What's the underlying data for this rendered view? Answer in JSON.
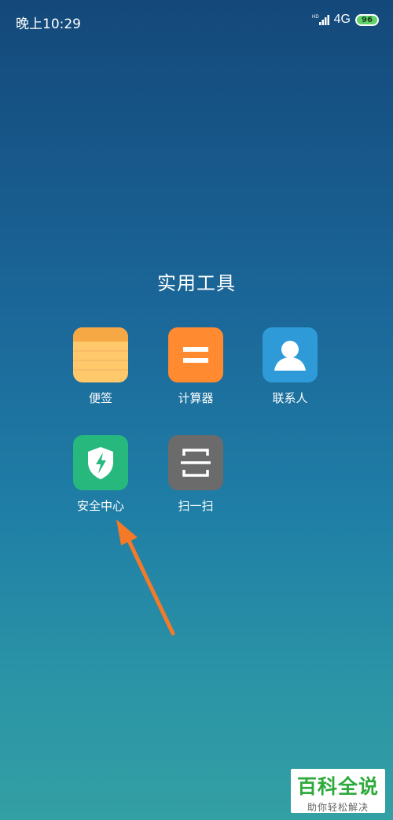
{
  "status_bar": {
    "time": "晚上10:29",
    "network": "4G",
    "battery": "96"
  },
  "folder": {
    "title": "实用工具",
    "apps": [
      {
        "label": "便签",
        "icon": "notes-icon",
        "color": "#ffc86b"
      },
      {
        "label": "计算器",
        "icon": "calculator-icon",
        "color": "#ff8a30"
      },
      {
        "label": "联系人",
        "icon": "contacts-icon",
        "color": "#2f9ad8"
      },
      {
        "label": "安全中心",
        "icon": "security-center-icon",
        "color": "#27b87e"
      },
      {
        "label": "扫一扫",
        "icon": "scanner-icon",
        "color": "#6b6b6b"
      }
    ]
  },
  "annotation": {
    "arrow_color": "#f47a2a",
    "points_to": "安全中心"
  },
  "watermark": {
    "logo": "百科全说",
    "subtitle": "助你轻松解决"
  }
}
